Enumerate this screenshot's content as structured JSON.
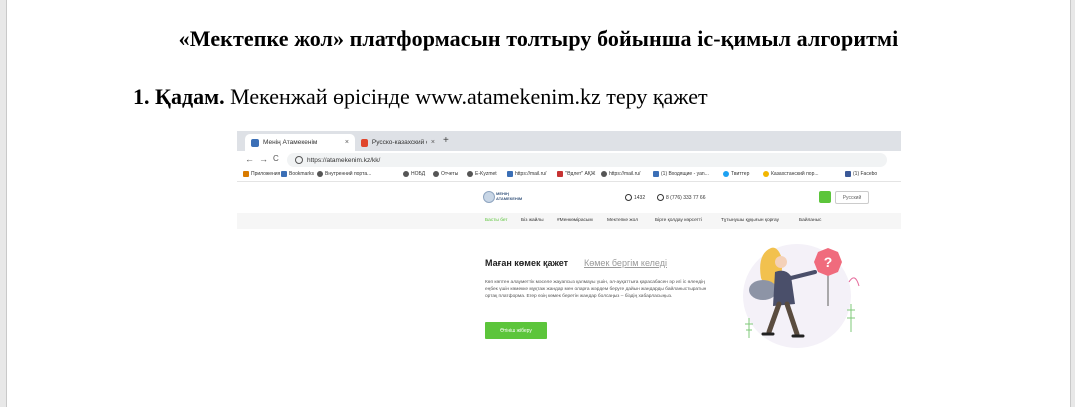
{
  "doc": {
    "title": "«Мектепке жол» платформасын толтыру бойынша іс-қимыл алгоритмі",
    "step_bold": "1. Қадам.",
    "step_text": " Мекенжай өрісінде www.atamekenim.kz теру қажет"
  },
  "browser": {
    "tabs": [
      {
        "label": "Менің Атамекенім",
        "close": "×",
        "icon_color": "#3b6fb6"
      },
      {
        "label": "Русско-казахский онлайн-пере",
        "close": "×",
        "icon_color": "#e0452b"
      }
    ],
    "new_tab": "+",
    "back": "←",
    "forward": "→",
    "reload": "C",
    "url": "https://atamekenim.kz/kk/",
    "bookmarks": [
      {
        "label": "Приложения",
        "icon_color": "#d97b00"
      },
      {
        "label": "Bookmarks",
        "icon_color": "#3b6fb6"
      },
      {
        "label": "Внутренний порта...",
        "icon_color": "#555555"
      },
      {
        "label": "НОБД",
        "icon_color": "#555555"
      },
      {
        "label": "Отчеты",
        "icon_color": "#555555"
      },
      {
        "label": "E-Kyzmet",
        "icon_color": "#555555"
      },
      {
        "label": "https://mail.ru/",
        "icon_color": "#3b6fb6"
      },
      {
        "label": "\"Әдлет\" АҚЖ",
        "icon_color": "#c73333"
      },
      {
        "label": "https://mail.ru/",
        "icon_color": "#555555"
      },
      {
        "label": "(1) Входящие - yan...",
        "icon_color": "#3b6fb6"
      },
      {
        "label": "Твиттер",
        "icon_color": "#1da1f2"
      },
      {
        "label": "Казахстанский пор...",
        "icon_color": "#f2b600"
      },
      {
        "label": "(1) Facebo",
        "icon_color": "#3b5998"
      }
    ]
  },
  "site": {
    "logo_line1": "МЕНІҢ",
    "logo_line2": "АТАМЕКЕНІМ",
    "phone_short": "1432",
    "phone_full": "8 (776) 333 77 66",
    "lang": "Русский",
    "menu": [
      {
        "label": "Басты бет",
        "active": true
      },
      {
        "label": "Біз жайлы",
        "active": false
      },
      {
        "label": "#Менкөмірасым",
        "active": false
      },
      {
        "label": "Мектепке жол",
        "active": false
      },
      {
        "label": "Біргe қолдау көрсетті",
        "active": false
      },
      {
        "label": "Тұтынушы құқығын қорғау",
        "active": false
      },
      {
        "label": "Байланыс",
        "active": false
      }
    ],
    "heading_active": "Маған көмек қажет",
    "heading_inactive": "Көмек бергім келеді",
    "paragraph": "Көп көптен алауметтік мәселе жауапсыз қалмауы үшін, әл-ауқаттыға қарасабасен әр игі іс өлендің еңбек үшін көмекке мұқтаж жандар мен оларға жәрдем беруге дайын жандарды байланыстыратын ортақ платформа. Егер өзің көмек беретін жандар болсаңыз – біздің хабарласыңыз.",
    "button": "Өтініш жіберу",
    "accent": "#5cc53b"
  }
}
